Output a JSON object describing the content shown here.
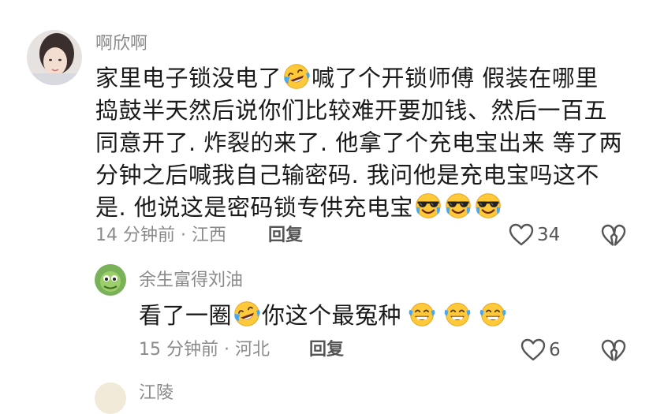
{
  "comment": {
    "username": "啊欣啊",
    "lines": [
      [
        "家里电子锁没电了",
        "[laugh-cry-emoji]",
        "喊了个开锁师傅 假装在哪里"
      ],
      [
        "捣鼓半天然后说你们比较难开要加钱、然后一百五"
      ],
      [
        "同意开了. 炸裂的来了. 他拿了个充电宝出来 等了两"
      ],
      [
        "分钟之后喊我自己输密码. 我问他是充电宝吗这不"
      ],
      [
        "是. 他说这是密码锁专供充电宝",
        "[sunglasses-cry-emoji]",
        "[sunglasses-cry-emoji]",
        "[sunglasses-cry-emoji]"
      ]
    ],
    "time_location": "14 分钟前 · 江西",
    "reply_label": "回复",
    "like_count": "34"
  },
  "reply": {
    "username": "余生富得刘油",
    "text_before": "看了一圈",
    "text_after": "你这个最冤种",
    "time_location": "15 分钟前 · 河北",
    "reply_label": "回复",
    "like_count": "6"
  },
  "next_reply": {
    "username": "江陵"
  },
  "colors": {
    "text": "#1a1a1a",
    "muted": "#8a8a8a",
    "emoji_yellow": "#FFC93A",
    "tear_blue": "#4AA8F0"
  },
  "icons": {
    "like": "heart-outline-icon",
    "dislike": "broken-heart-icon",
    "emoji_1": "laugh-cry-emoji",
    "emoji_2": "sunglasses-cry-emoji",
    "emoji_3": "grinning-sweat-emoji"
  }
}
